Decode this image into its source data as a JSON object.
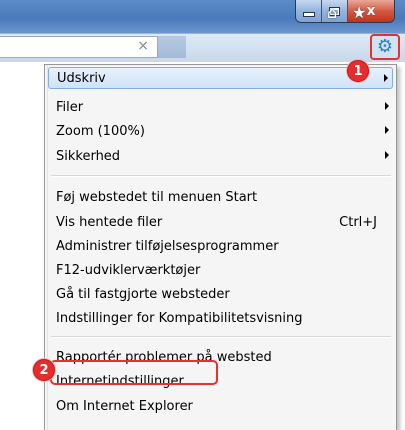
{
  "window": {
    "caption_close_symbol": "x"
  },
  "toolbar": {
    "tab_close_symbol": "×",
    "icons": [
      "home-icon",
      "star-icon",
      "gear-icon"
    ]
  },
  "callouts": {
    "step1": "1",
    "step2": "2",
    "color": "#e53131"
  },
  "menu": {
    "highlight_color": "#cfe2f7",
    "items": [
      {
        "label": "Udskriv",
        "submenu": true
      },
      {
        "label": "Filer",
        "submenu": true
      },
      {
        "label": "Zoom (100%)",
        "submenu": true
      },
      {
        "label": "Sikkerhed",
        "submenu": true
      },
      {
        "label": "Føj webstedet til menuen Start"
      },
      {
        "label": "Vis hentede filer",
        "shortcut": "Ctrl+J"
      },
      {
        "label": "Administrer tilføjelsesprogrammer"
      },
      {
        "label": "F12-udviklerværktøjer"
      },
      {
        "label": "Gå til fastgjorte websteder"
      },
      {
        "label": "Indstillinger for Kompatibilitetsvisning"
      },
      {
        "label": "Rapportér problemer på websted"
      },
      {
        "label": "Internetindstillinger"
      },
      {
        "label": "Om Internet Explorer"
      }
    ]
  }
}
